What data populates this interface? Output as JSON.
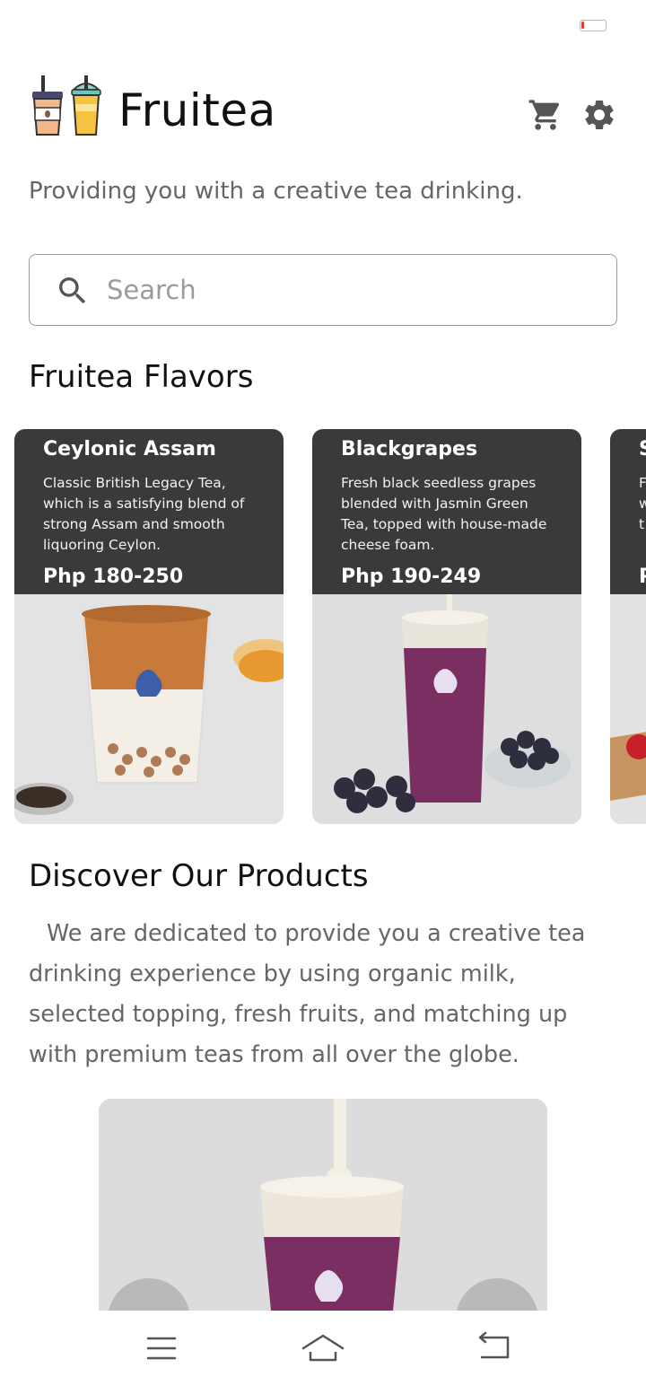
{
  "app": {
    "title": "Fruitea",
    "subtitle": "Providing you with a creative tea drinking."
  },
  "icons": {
    "logo": "bubble-tea-cups-logo",
    "cart": "cart-icon",
    "settings": "gear-icon",
    "search": "search-icon",
    "nav_menu": "menu-icon",
    "nav_home": "home-icon",
    "nav_back": "back-icon"
  },
  "search": {
    "placeholder": "Search"
  },
  "flavors": {
    "title": "Fruitea Flavors",
    "items": [
      {
        "name": "Ceylonic Assam",
        "description": "Classic British Legacy Tea, which is a satisfying blend of strong Assam and smooth liquoring Ceylon.",
        "price": "Php 180-250"
      },
      {
        "name": "Blackgrapes",
        "description": "Fresh black seedless grapes blended with Jasmin Green Tea, topped with house-made cheese foam.",
        "price": "Php 190-249"
      },
      {
        "name": "S",
        "description": "F w t c",
        "price": "P"
      }
    ]
  },
  "discover": {
    "title": "Discover Our Products",
    "text": "We are dedicated to provide you a creative tea drinking experience by using organic milk, selected topping, fresh fruits, and matching up with premium teas from all over the globe."
  },
  "colors": {
    "card_overlay": "#3a3a3a",
    "subtitle_text": "#666666",
    "battery_low": "#e53935"
  }
}
